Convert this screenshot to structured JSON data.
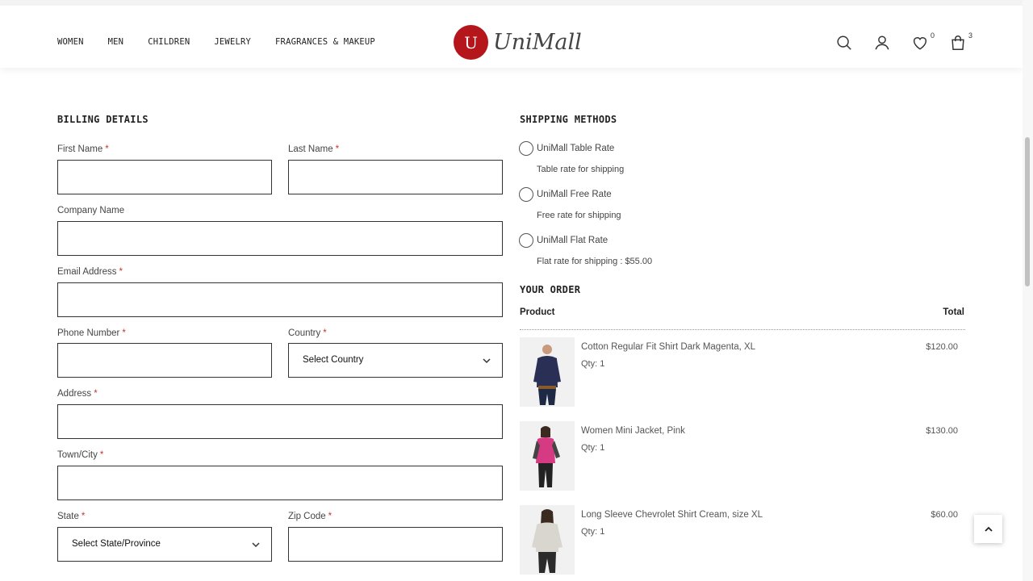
{
  "nav": {
    "items": [
      "WOMEN",
      "MEN",
      "CHILDREN",
      "JEWELRY",
      "FRAGRANCES & MAKEUP"
    ]
  },
  "logo": {
    "mark": "U",
    "text": "UniMall"
  },
  "header_icons": {
    "search": "search-icon",
    "account": "user-icon",
    "wishlist": "heart-icon",
    "wishlist_count": "0",
    "cart": "bag-icon",
    "cart_count": "3"
  },
  "billing": {
    "title": "BILLING DETAILS",
    "first_name_label": "First Name",
    "last_name_label": "Last Name",
    "company_label": "Company Name",
    "email_label": "Email Address",
    "phone_label": "Phone Number",
    "country_label": "Country",
    "country_value": "Select Country",
    "address_label": "Address",
    "town_label": "Town/City",
    "state_label": "State",
    "state_value": "Select State/Province",
    "zip_label": "Zip Code",
    "required_mark": "*"
  },
  "shipping": {
    "title": "SHIPPING METHODS",
    "methods": [
      {
        "name": "UniMall Table Rate",
        "desc": "Table rate for shipping"
      },
      {
        "name": "UniMall Free Rate",
        "desc": "Free rate for shipping"
      },
      {
        "name": "UniMall Flat Rate",
        "desc": "Flat rate for shipping : $55.00"
      }
    ]
  },
  "order": {
    "title": "YOUR ORDER",
    "col_product": "Product",
    "col_total": "Total",
    "items": [
      {
        "name": "Cotton Regular Fit Shirt Dark Magenta, XL",
        "qty": "Qty: 1",
        "price": "$120.00"
      },
      {
        "name": "Women Mini Jacket, Pink",
        "qty": "Qty: 1",
        "price": "$130.00"
      },
      {
        "name": "Long Sleeve Chevrolet Shirt Cream, size XL",
        "qty": "Qty: 1",
        "price": "$60.00"
      }
    ]
  },
  "colors": {
    "brand": "#b5161c",
    "required": "#c0392b",
    "border": "#333333"
  }
}
